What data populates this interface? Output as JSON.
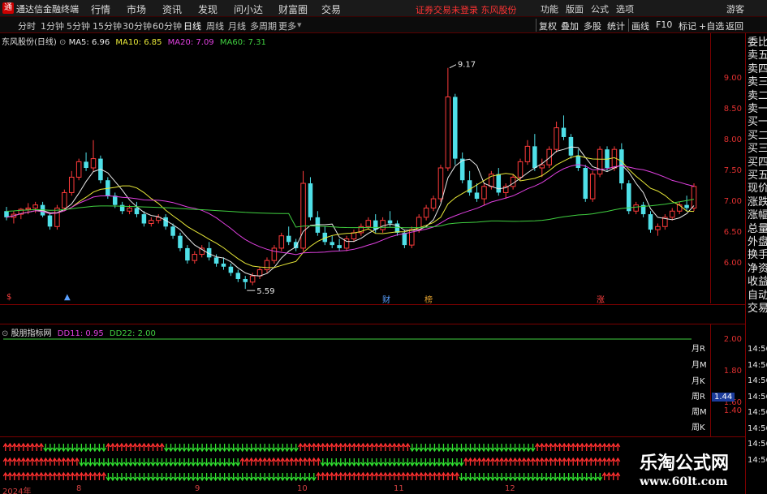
{
  "titlebar": {
    "logo": "通",
    "app_name": "通达信金融终端",
    "menu": [
      "行情",
      "市场",
      "资讯",
      "发现",
      "问小达",
      "财富圈",
      "交易"
    ],
    "notice": "证券交易未登录  东风股份",
    "right_menu": [
      "功能",
      "版面",
      "公式",
      "选项"
    ],
    "guest": "游客"
  },
  "toolbar": {
    "periods": [
      "分时",
      "1分钟",
      "5分钟",
      "15分钟",
      "30分钟",
      "60分钟",
      "日线",
      "周线",
      "月线",
      "多周期",
      "更多"
    ],
    "active_period": "日线",
    "right_buttons": [
      "复权",
      "叠加",
      "多股",
      "统计",
      "画线",
      "F10",
      "标记",
      "+自选",
      "返回"
    ]
  },
  "chart": {
    "stock_label": "东风股份(日线)",
    "ma": [
      {
        "name": "MA5",
        "value": "6.96",
        "color": "#e8e8e8"
      },
      {
        "name": "MA10",
        "value": "6.85",
        "color": "#e8e838"
      },
      {
        "name": "MA20",
        "value": "7.09",
        "color": "#e040e0"
      },
      {
        "name": "MA60",
        "value": "7.31",
        "color": "#40d040"
      }
    ],
    "price_labels": [
      "9.00",
      "8.50",
      "8.00",
      "7.50",
      "7.00",
      "6.50",
      "6.00"
    ],
    "high_annotation": "9.17",
    "low_annotation": "5.59",
    "markers": [
      {
        "text": "财",
        "color": "#5aa0ff"
      },
      {
        "text": "榜",
        "color": "#e0a030"
      },
      {
        "text": "涨",
        "color": "#ff4040"
      }
    ]
  },
  "indicator": {
    "name": "股朋指标网",
    "dd11_label": "DD11: 0.95",
    "dd22_label": "DD22: 2.00",
    "axis": [
      "2.00",
      "1.80",
      "1.60",
      "1.44",
      "1.40"
    ],
    "row_labels": [
      "月R",
      "月M",
      "月K",
      "周R",
      "周M",
      "周K",
      "周R"
    ]
  },
  "right_panel": {
    "items": [
      "委比",
      "卖五",
      "卖四",
      "卖三",
      "卖二",
      "卖一",
      "买一",
      "买二",
      "买三",
      "买四",
      "买五",
      "现价",
      "涨跌",
      "涨幅",
      "总量",
      "外盘",
      "换手",
      "净资",
      "收益",
      "自动",
      "交易"
    ],
    "times": [
      "14:56",
      "14:56",
      "14:56",
      "14:56",
      "14:56",
      "14:56",
      "14:56",
      "14:56"
    ]
  },
  "axis_dates": [
    "2024年",
    "8",
    "9",
    "10",
    "11",
    "12"
  ],
  "watermark": {
    "line1": "乐淘公式网",
    "line2": "www.60lt.com"
  },
  "chart_data": {
    "type": "candlestick",
    "ylim": [
      5.5,
      9.6
    ],
    "ohlc": [
      [
        6.85,
        6.92,
        6.7,
        6.75
      ],
      [
        6.75,
        6.85,
        6.65,
        6.8
      ],
      [
        6.8,
        6.9,
        6.72,
        6.88
      ],
      [
        6.88,
        6.98,
        6.8,
        6.9
      ],
      [
        6.9,
        7.0,
        6.82,
        6.95
      ],
      [
        6.95,
        7.0,
        6.75,
        6.78
      ],
      [
        6.78,
        6.82,
        6.55,
        6.6
      ],
      [
        6.6,
        6.95,
        6.55,
        6.9
      ],
      [
        6.9,
        7.2,
        6.85,
        7.15
      ],
      [
        7.15,
        7.5,
        7.1,
        7.4
      ],
      [
        7.4,
        7.7,
        7.35,
        7.65
      ],
      [
        7.65,
        7.8,
        7.5,
        7.55
      ],
      [
        7.55,
        8.0,
        7.5,
        7.7
      ],
      [
        7.7,
        7.75,
        7.3,
        7.35
      ],
      [
        7.35,
        7.4,
        7.05,
        7.1
      ],
      [
        7.1,
        7.15,
        6.9,
        6.95
      ],
      [
        6.95,
        7.0,
        6.8,
        6.85
      ],
      [
        6.85,
        6.95,
        6.8,
        6.9
      ],
      [
        6.9,
        7.0,
        6.75,
        6.8
      ],
      [
        6.8,
        6.85,
        6.6,
        6.65
      ],
      [
        6.65,
        6.75,
        6.6,
        6.7
      ],
      [
        6.7,
        6.8,
        6.65,
        6.75
      ],
      [
        6.75,
        6.8,
        6.55,
        6.6
      ],
      [
        6.6,
        6.65,
        6.4,
        6.45
      ],
      [
        6.45,
        6.5,
        6.2,
        6.25
      ],
      [
        6.25,
        6.3,
        6.0,
        6.05
      ],
      [
        6.05,
        6.2,
        6.0,
        6.15
      ],
      [
        6.15,
        6.3,
        6.1,
        6.25
      ],
      [
        6.25,
        6.35,
        6.05,
        6.1
      ],
      [
        6.1,
        6.15,
        5.95,
        6.0
      ],
      [
        6.0,
        6.1,
        5.9,
        5.95
      ],
      [
        5.95,
        6.0,
        5.8,
        5.85
      ],
      [
        5.85,
        5.9,
        5.7,
        5.75
      ],
      [
        5.75,
        5.8,
        5.59,
        5.7
      ],
      [
        5.7,
        5.85,
        5.65,
        5.8
      ],
      [
        5.8,
        5.95,
        5.75,
        5.9
      ],
      [
        5.9,
        6.1,
        5.85,
        6.05
      ],
      [
        6.05,
        6.3,
        6.0,
        6.25
      ],
      [
        6.25,
        6.5,
        6.2,
        6.45
      ],
      [
        6.45,
        6.6,
        6.3,
        6.35
      ],
      [
        6.35,
        6.4,
        6.2,
        6.25
      ],
      [
        6.25,
        7.5,
        6.2,
        7.3
      ],
      [
        7.3,
        7.4,
        6.7,
        6.75
      ],
      [
        6.75,
        6.85,
        6.45,
        6.5
      ],
      [
        6.5,
        6.6,
        6.3,
        6.35
      ],
      [
        6.35,
        6.45,
        6.25,
        6.3
      ],
      [
        6.3,
        6.4,
        6.2,
        6.25
      ],
      [
        6.25,
        6.45,
        6.2,
        6.4
      ],
      [
        6.4,
        6.55,
        6.35,
        6.5
      ],
      [
        6.5,
        6.65,
        6.45,
        6.6
      ],
      [
        6.6,
        6.75,
        6.55,
        6.7
      ],
      [
        6.7,
        6.8,
        6.5,
        6.55
      ],
      [
        6.55,
        6.75,
        6.5,
        6.7
      ],
      [
        6.7,
        6.85,
        6.6,
        6.65
      ],
      [
        6.65,
        6.7,
        6.45,
        6.5
      ],
      [
        6.5,
        6.55,
        6.25,
        6.3
      ],
      [
        6.3,
        6.6,
        6.25,
        6.55
      ],
      [
        6.55,
        6.8,
        6.5,
        6.75
      ],
      [
        6.75,
        6.95,
        6.7,
        6.9
      ],
      [
        6.9,
        7.1,
        6.85,
        7.05
      ],
      [
        7.05,
        7.6,
        7.0,
        7.55
      ],
      [
        7.55,
        9.17,
        7.5,
        8.7
      ],
      [
        8.7,
        8.75,
        7.6,
        7.7
      ],
      [
        7.7,
        7.8,
        7.3,
        7.35
      ],
      [
        7.35,
        7.5,
        7.1,
        7.15
      ],
      [
        7.15,
        7.3,
        7.0,
        7.05
      ],
      [
        7.05,
        7.3,
        6.95,
        7.25
      ],
      [
        7.25,
        7.5,
        7.2,
        7.45
      ],
      [
        7.45,
        7.55,
        7.1,
        7.15
      ],
      [
        7.15,
        7.3,
        7.05,
        7.25
      ],
      [
        7.25,
        7.45,
        7.2,
        7.4
      ],
      [
        7.4,
        7.7,
        7.35,
        7.65
      ],
      [
        7.65,
        8.0,
        7.6,
        7.9
      ],
      [
        7.9,
        8.1,
        7.5,
        7.55
      ],
      [
        7.55,
        7.7,
        7.4,
        7.6
      ],
      [
        7.6,
        7.9,
        7.55,
        7.85
      ],
      [
        7.85,
        8.3,
        7.8,
        8.2
      ],
      [
        8.2,
        8.4,
        8.0,
        8.05
      ],
      [
        8.05,
        8.1,
        7.7,
        7.75
      ],
      [
        7.75,
        7.85,
        7.5,
        7.55
      ],
      [
        7.55,
        7.6,
        7.0,
        7.05
      ],
      [
        7.05,
        7.5,
        7.0,
        7.45
      ],
      [
        7.45,
        7.9,
        7.4,
        7.85
      ],
      [
        7.85,
        7.9,
        7.5,
        7.55
      ],
      [
        7.55,
        7.9,
        7.5,
        7.85
      ],
      [
        7.85,
        7.95,
        7.2,
        7.3
      ],
      [
        7.3,
        7.35,
        6.8,
        6.85
      ],
      [
        6.85,
        7.0,
        6.8,
        6.95
      ],
      [
        6.95,
        7.0,
        6.75,
        6.8
      ],
      [
        6.8,
        6.85,
        6.5,
        6.55
      ],
      [
        6.55,
        6.65,
        6.45,
        6.6
      ],
      [
        6.6,
        6.8,
        6.55,
        6.75
      ],
      [
        6.75,
        6.9,
        6.7,
        6.85
      ],
      [
        6.85,
        7.0,
        6.8,
        6.95
      ],
      [
        6.95,
        7.1,
        6.85,
        6.9
      ],
      [
        6.9,
        7.3,
        6.85,
        7.25
      ]
    ],
    "series": [
      {
        "name": "MA5",
        "value": 6.96
      },
      {
        "name": "MA10",
        "value": 6.85
      },
      {
        "name": "MA20",
        "value": 7.09
      },
      {
        "name": "MA60",
        "value": 7.31
      }
    ]
  }
}
